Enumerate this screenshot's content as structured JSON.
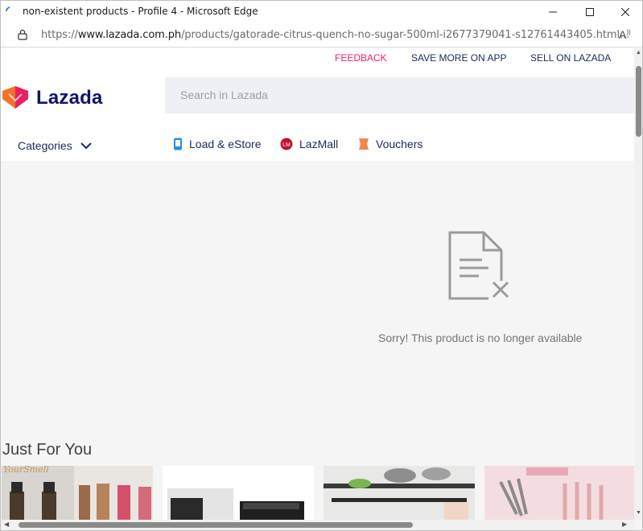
{
  "window": {
    "title": "non-existent products - Profile 4 - Microsoft Edge",
    "url_prefix": "https://",
    "url_domain": "www.lazada.com.ph",
    "url_path": "/products/gatorade-citrus-quench-no-sugar-500ml-i2677379041-s12761443405.html..."
  },
  "topnav": {
    "feedback": "FEEDBACK",
    "save_more": "SAVE MORE ON APP",
    "sell": "SELL ON LAZADA"
  },
  "header": {
    "logo_text": "Lazada",
    "search_placeholder": "Search in Lazada",
    "categories": "Categories",
    "quick_links": [
      "Load & eStore",
      "LazMall",
      "Vouchers"
    ]
  },
  "empty_state": {
    "message": "Sorry! This product is no longer available"
  },
  "recommendations": {
    "title": "Just For You",
    "watermark": "YourSmell"
  },
  "colors": {
    "brand_navy": "#0f146d",
    "feedback_pink": "#e6236f",
    "logo_orange": "#f57224",
    "logo_pink": "#e91e63"
  }
}
